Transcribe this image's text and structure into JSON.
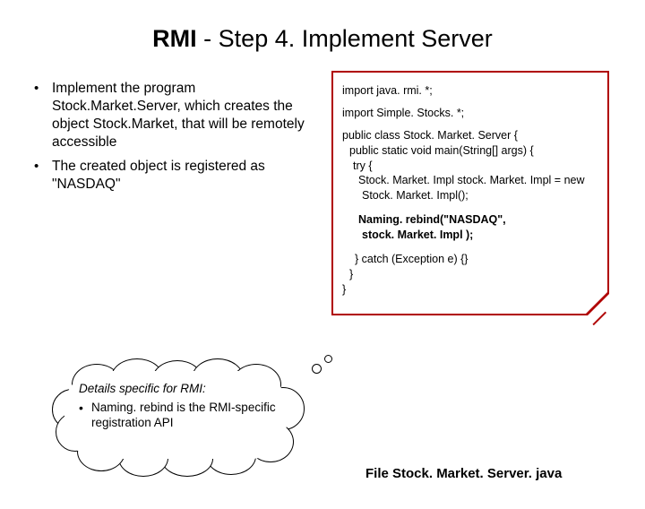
{
  "title_prefix": "RMI",
  "title_rest": " - Step 4. Implement Server",
  "bullet1": "Implement the program Stock.Market.Server, which creates the object Stock.Market, that will be remotely accessible",
  "bullet2": "The created object is registered as \"NASDAQ\"",
  "code": {
    "l0": "import java. rmi. *;",
    "l1": "import Simple. Stocks. *;",
    "l2": "public class Stock. Market. Server  {",
    "l3": "public static void main(String[] args) {",
    "l4": "try {",
    "l5": "Stock. Market. Impl stock. Market. Impl = new",
    "l5b": "Stock. Market. Impl();",
    "rebind1": "Naming. rebind(\"NASDAQ\",",
    "rebind2": "stock. Market. Impl );",
    "l6": "} catch (Exception e) {}",
    "l7": "}",
    "l8": "}"
  },
  "cloud": {
    "header": "Details specific for RMI:",
    "item_pre": "Naming. rebind",
    "item_post": "  is the RMI-specific registration API"
  },
  "caption": "File Stock. Market. Server. java"
}
